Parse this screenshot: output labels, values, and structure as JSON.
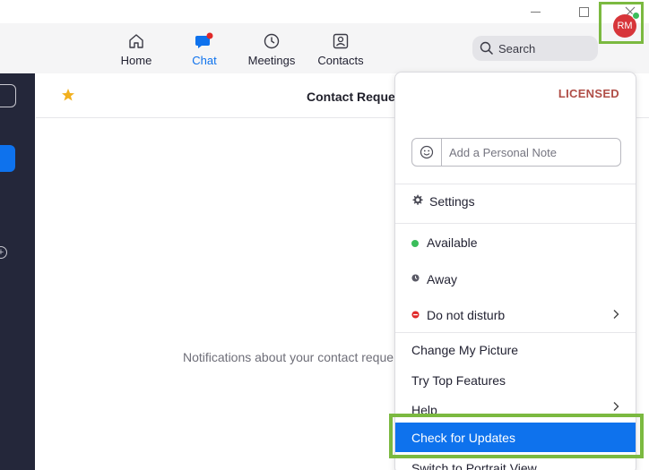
{
  "nav": {
    "home": "Home",
    "chat": "Chat",
    "meetings": "Meetings",
    "contacts": "Contacts"
  },
  "search": {
    "label": "Search"
  },
  "avatar": {
    "initials": "RM",
    "status_color": "#3bbd5b"
  },
  "main": {
    "title": "Contact Reque",
    "message": "Notifications about your contact reque"
  },
  "menu": {
    "license": "LICENSED",
    "note_placeholder": "Add a Personal Note",
    "settings": "Settings",
    "available": "Available",
    "away": "Away",
    "do_not_disturb": "Do not disturb",
    "change_picture": "Change My Picture",
    "top_features": "Try Top Features",
    "help": "Help",
    "check_updates": "Check for Updates",
    "portrait": "Switch to Portrait View"
  },
  "colors": {
    "accent": "#0e72ed",
    "highlight": "#7bb940",
    "available": "#3bbd5b",
    "dnd": "#e02828",
    "sidebar": "#24273a"
  }
}
